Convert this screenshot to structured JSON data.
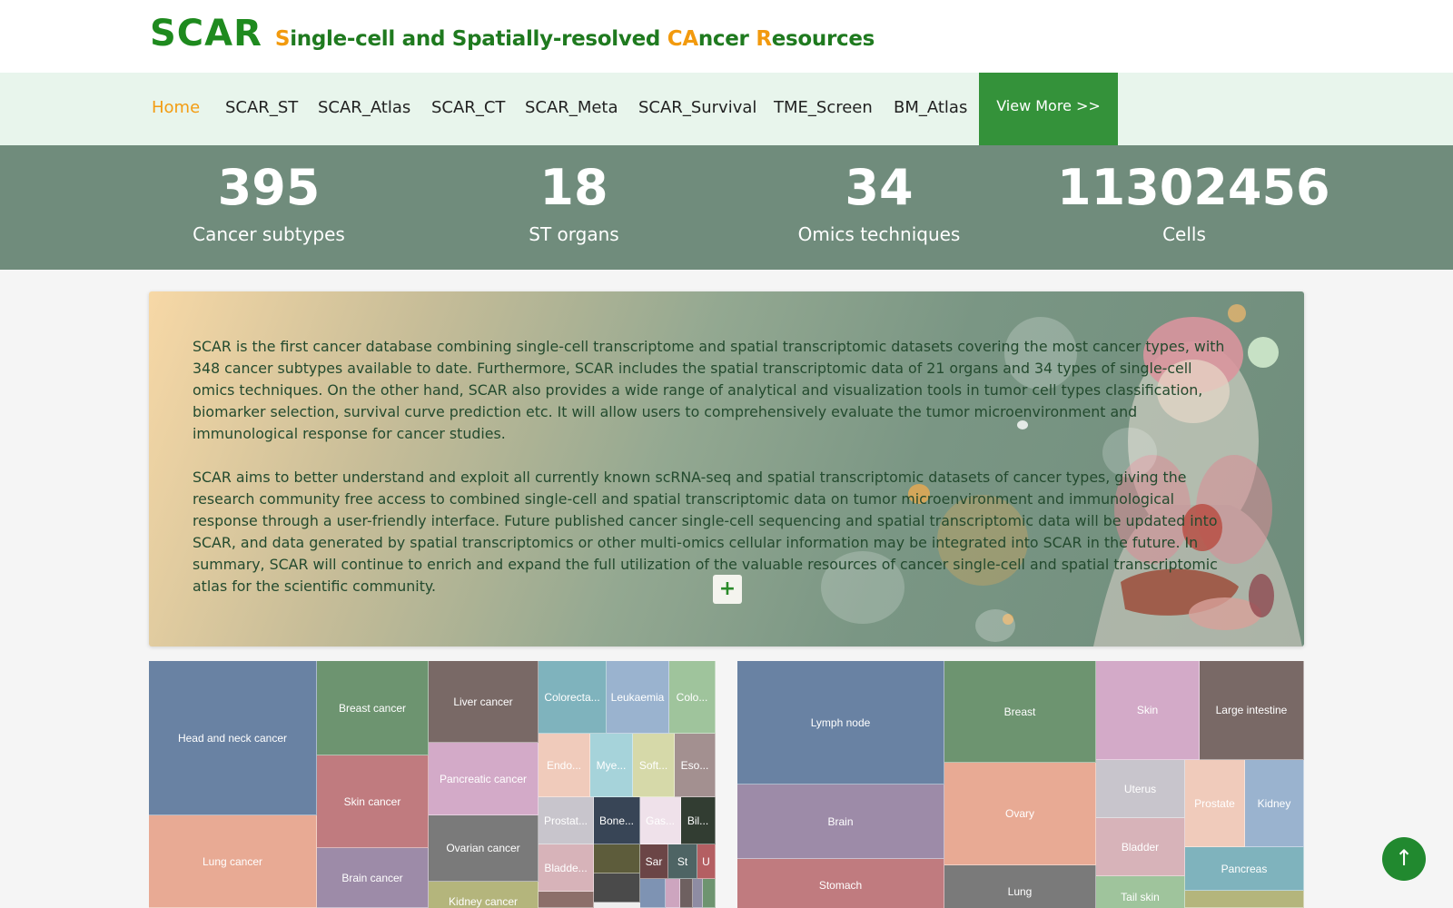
{
  "brand": {
    "main": "SCAR",
    "sub_1": "S",
    "sub_2": "ingle-cell and Spatially-resolved ",
    "sub_3": "CA",
    "sub_4": "ncer ",
    "sub_5": "R",
    "sub_6": "esources"
  },
  "nav": {
    "items": [
      "Home",
      "SCAR_ST",
      "SCAR_Atlas",
      "SCAR_CT",
      "SCAR_Meta",
      "SCAR_Survival",
      "TME_Screen",
      "BM_Atlas"
    ],
    "active": "Home",
    "view_more": "View More >>"
  },
  "stats": [
    {
      "num": "395",
      "label": "Cancer subtypes"
    },
    {
      "num": "18",
      "label": "ST organs"
    },
    {
      "num": "34",
      "label": "Omics techniques"
    },
    {
      "num": "11302456",
      "label": "Cells"
    }
  ],
  "intro": {
    "p1": "SCAR is the first cancer database combining single-cell transcriptome and spatial transcriptomic datasets covering the most cancer types, with 348 cancer subtypes available to date. Furthermore, SCAR includes the spatial transcriptomic data of 21 organs and 34 types of single-cell omics techniques. On the other hand, SCAR also provides a wide range of analytical and visualization tools in tumor cell types classification, biomarker selection, survival curve prediction etc. It will allow users to comprehensively evaluate the tumor microenvironment and immunological response for cancer studies.",
    "p2": "SCAR aims to better understand and exploit all currently known scRNA-seq and spatial transcriptomic datasets of cancer types, giving the research community free access to combined single-cell and spatial transcriptomic data on tumor microenvironment and immunological response through a user-friendly interface. Future published cancer single-cell sequencing and spatial transcriptomic data will be updated into SCAR, and data generated by spatial transcriptomics or other multi-omics cellular information may be integrated into SCAR in the future. In summary, SCAR will continue to enrich and expand the full utilization of the valuable resources of cancer single-cell and spatial transcriptomic atlas for the scientific community.",
    "plus": "+"
  },
  "treemap_cancer": [
    {
      "label": "Head and neck cancer",
      "color": "#6982a3"
    },
    {
      "label": "Lung cancer",
      "color": "#e8aa94"
    },
    {
      "label": "Breast cancer",
      "color": "#6d9470"
    },
    {
      "label": "Skin cancer",
      "color": "#c07b7f"
    },
    {
      "label": "Brain cancer",
      "color": "#9d8ba8"
    },
    {
      "label": "Liver cancer",
      "color": "#796966"
    },
    {
      "label": "Pancreatic cancer",
      "color": "#d3aac8"
    },
    {
      "label": "Ovarian cancer",
      "color": "#7a7a7a"
    },
    {
      "label": "Kidney cancer",
      "color": "#b4b57c"
    },
    {
      "label": "Colorecta...",
      "color": "#7fb3bd"
    },
    {
      "label": "Leukaemia",
      "color": "#9ab3cf"
    },
    {
      "label": "Colo...",
      "color": "#9fc49c"
    },
    {
      "label": "Endo...",
      "color": "#f0cbbb"
    },
    {
      "label": "Mye...",
      "color": "#a6d3da"
    },
    {
      "label": "Soft...",
      "color": "#d6d9a9"
    },
    {
      "label": "Eso...",
      "color": "#a39090"
    },
    {
      "label": "Prostat...",
      "color": "#c8c5cc"
    },
    {
      "label": "Bone...",
      "color": "#384556"
    },
    {
      "label": "Gas...",
      "color": "#efe1ea"
    },
    {
      "label": "Bil...",
      "color": "#323d32"
    },
    {
      "label": "Bladde...",
      "color": "#d7b3b9"
    },
    {
      "label": "Sar",
      "color": "#6b4546"
    },
    {
      "label": "St",
      "color": "#4e6464"
    },
    {
      "label": "U",
      "color": "#b45f62"
    },
    {
      "label": "",
      "color": "#5d5c3b"
    },
    {
      "label": "",
      "color": "#4a4a4a"
    },
    {
      "label": "",
      "color": "#8c6f6a"
    },
    {
      "label": "",
      "color": "#7e93b3"
    },
    {
      "label": "",
      "color": "#cda5bf"
    },
    {
      "label": "",
      "color": "#6e6060"
    },
    {
      "label": "",
      "color": "#8e8ca3"
    },
    {
      "label": "",
      "color": "#6e9470"
    }
  ],
  "treemap_organ": [
    {
      "label": "Lymph node",
      "color": "#6982a3"
    },
    {
      "label": "Brain",
      "color": "#9d8ba8"
    },
    {
      "label": "Stomach",
      "color": "#c07b7f"
    },
    {
      "label": "Breast",
      "color": "#6d9470"
    },
    {
      "label": "Ovary",
      "color": "#e8aa94"
    },
    {
      "label": "Lung",
      "color": "#7a7a7a"
    },
    {
      "label": "Skin",
      "color": "#d3aac8"
    },
    {
      "label": "Large intestine",
      "color": "#796966"
    },
    {
      "label": "Uterus",
      "color": "#c8c5cc"
    },
    {
      "label": "Prostate",
      "color": "#f0cbbb"
    },
    {
      "label": "Kidney",
      "color": "#9ab3cf"
    },
    {
      "label": "Bladder",
      "color": "#d7b3b9"
    },
    {
      "label": "Pancreas",
      "color": "#7fb3bd"
    },
    {
      "label": "Tail skin",
      "color": "#9fc49c"
    },
    {
      "label": "",
      "color": "#b4b57c"
    }
  ],
  "scroll_top": "↑"
}
